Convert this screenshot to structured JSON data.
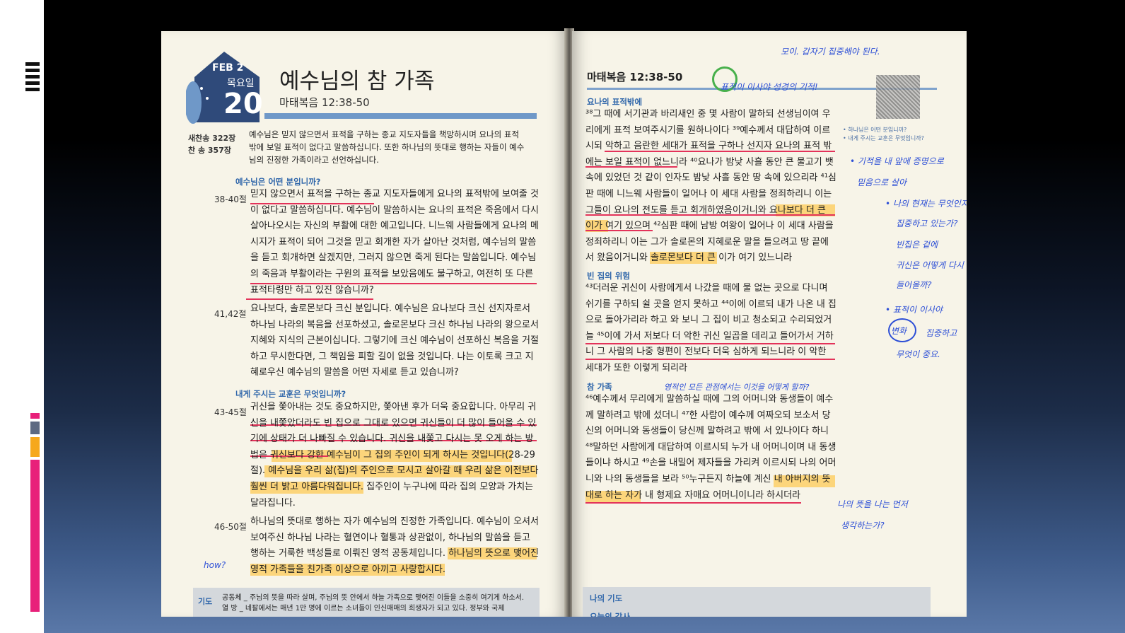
{
  "left_page": {
    "month": "FEB 2",
    "weekday": "목요일",
    "day": "20",
    "title": "예수님의 참 가족",
    "reference": "마태복음 12:38-50",
    "hymn1": "새찬송 322장",
    "hymn2": "찬  송 357장",
    "intro": [
      "예수님은 믿지 않으면서 표적을 구하는 종교 지도자들을 책망하시며 요나의 표적",
      "밖에 보일 표적이 없다고 말씀하십니다. 또한 하나님의 뜻대로 행하는 자들이 예수",
      "님의 진정한 가족이라고 선언하십니다."
    ],
    "q1": "예수님은 어떤 분입니까?",
    "v1_no": "38-40절",
    "v1": [
      "믿지 않으면서 표적을 구하는 종교 지도자들에게 요나의 표적밖에 보여줄 것",
      "이 없다고 말씀하십니다. 예수님이 말씀하시는 요나의 표적은 죽음에서 다시",
      "살아나오시는 자신의 부활에 대한 예고입니다. 니느웨 사람들에게 요나의 메",
      "시지가 표적이 되어 그것을 믿고 회개한 자가 살아난 것처럼, 예수님의 말씀",
      "을 듣고 회개하면 살겠지만, 그러지 않으면 죽게 된다는 말씀입니다. 예수님",
      "의 죽음과 부활이라는 구원의 표적을 보았음에도 불구하고, 여전히 또 다른",
      "표적타령만 하고 있진 않습니까?"
    ],
    "v2_no": "41,42절",
    "v2": [
      "요나보다, 솔로몬보다 크신 분입니다. 예수님은 요나보다 크신 선지자로서",
      "하나님 나라의 복음을 선포하셨고, 솔로몬보다 크신 하나님 나라의 왕으로서",
      "지혜와 지식의 근본이십니다. 그렇기에 크신 예수님이 선포하신 복음을 거절",
      "하고 무시한다면, 그 책임을 피할 길이 없을 것입니다. 나는 이토록 크고 지",
      "혜로우신 예수님의 말씀을 어떤 자세로 듣고 있습니까?"
    ],
    "q2": "내게 주시는 교훈은 무엇입니까?",
    "v3_no": "43-45절",
    "v3": [
      "귀신을 쫓아내는 것도 중요하지만, 쫓아낸 후가 더욱 중요합니다. 아무리 귀",
      "신을 내쫓았더라도 빈 집으로 그대로 있으면 귀신들이 더 많이 들어올 수 있",
      "기에 상태가 더 나빠질 수 있습니다. 귀신을 내쫓고 다시는 못 오게 하는 방",
      "법은 귀신보다 강한 예수님이 그 집의 주인이 되게 하시는 것입니다(28-29",
      "절). 예수님을 우리 삶(집)의 주인으로 모시고 살아갈 때 우리 삶은 이전보다",
      "훨씬 더 밝고 아름다워집니다. 집주인이 누구냐에 따라 집의 모양과 가치는",
      "달라집니다."
    ],
    "v4_no": "46-50절",
    "v4": [
      "하나님의 뜻대로 행하는 자가 예수님의 진정한 가족입니다. 예수님이 오셔서",
      "보여주신 하나님 나라는 혈연이나 혈통과 상관없이, 하나님의 말씀을 듣고",
      "행하는 거룩한 백성들로 이뤄진 영적 공동체입니다. 하나님의 뜻으로 맺어진",
      "영적 가족들을 친가족 이상으로 아끼고 사랑합시다."
    ],
    "prayer_label": "기도",
    "prayer_community": "공동체 _ 주님의 뜻을 따라 살며, 주님의 뜻 안에서 하늘 가족으로 맺어진 이들을 소중히 여기게 하소서.",
    "prayer_nation": "열  방 _ 네팔에서는 매년 1만 명에 이르는 소녀들이 인신매매의 희생자가 되고 있다. 정부와 국제",
    "margin_note": "how?"
  },
  "right_page": {
    "reference": "마태복음 12:38-50",
    "sec1": "요나의 표적밖에",
    "sec1_text": [
      "³⁸그 때에 서기관과 바리새인 중 몇 사람이 말하되 선생님이여 우",
      "리에게 표적 보여주시기를 원하나이다 ³⁹예수께서 대답하여 이르",
      "시되 악하고 음란한 세대가 표적을 구하나 선지자 요나의 표적 밖",
      "에는 보일 표적이 없느니라 ⁴⁰요나가 밤낮 사흘 동안 큰 물고기 뱃",
      "속에 있었던 것 같이 인자도 밤낮 사흘 동안 땅 속에 있으리라 ⁴¹심",
      "판 때에 니느웨 사람들이 일어나 이 세대 사람을 정죄하리니 이는",
      "그들이 요나의 전도를 듣고 회개하였음이거니와 요나보다 더 큰",
      "이가 여기 있으며 ⁴²심판 때에 남방 여왕이 일어나 이 세대 사람을",
      "정죄하리니 이는 그가 솔로몬의 지혜로운 말을 들으려고 땅 끝에",
      "서 왔음이거니와 솔로몬보다 더 큰 이가 여기 있느니라"
    ],
    "sec2": "빈 집의 위험",
    "sec2_text": [
      "⁴³더러운 귀신이 사람에게서 나갔을 때에 물 없는 곳으로 다니며",
      "쉬기를 구하되 쉴 곳을 얻지 못하고 ⁴⁴이에 이르되 내가 나온 내 집",
      "으로 돌아가리라 하고 와 보니 그 집이 비고 청소되고 수리되었거",
      "늘 ⁴⁵이에 가서 저보다 더 악한 귀신 일곱을 데리고 들어가서 거하",
      "니 그 사람의 나중 형편이 전보다 더욱 심하게 되느니라 이 악한",
      "세대가 또한 이렇게 되리라"
    ],
    "sec3": "참 가족",
    "sec3_text": [
      "⁴⁶예수께서 무리에게 말씀하실 때에 그의 어머니와 동생들이 예수",
      "께 말하려고 밖에 섰더니 ⁴⁷한 사람이 예수께 여짜오되 보소서 당",
      "신의 어머니와 동생들이 당신께 말하려고 밖에 서 있나이다 하니",
      "⁴⁸말하던 사람에게 대답하여 이르시되 누가 내 어머니이며 내 동생",
      "들이냐 하시고 ⁴⁹손을 내밀어 제자들을 가리켜 이르시되 나의 어머",
      "니와 나의 동생들을 보라 ⁵⁰누구든지 하늘에 계신 내 아버지의 뜻",
      "대로 하는 자가 내 형제요 자매요 어머니이니라 하시더라"
    ],
    "side_questions": [
      "• 하나님은 어떤 분입니까?",
      "• 내게 주시는 교훈은 무엇입니까?"
    ],
    "my_prayer": "나의 기도",
    "today_thanks": "오늘의 감사",
    "notes": {
      "top": "모이. 갑자기 집중해야 된다.",
      "top2": "표적이   이사야   성경의   기적!",
      "r1": "• 기적을  내  앞에  증명으로",
      "r1b": "믿음으로  살아",
      "r2": "• 나의  현재는  무엇인지",
      "r2b": "집중하고  있는가?",
      "r2c": "빈집은  겉에",
      "r2d": "귀신은  어떻게  다시",
      "r2e": "들어올까?",
      "r3": "• 표적이   이사야",
      "r3b": "변화",
      "r3c": "집중하고",
      "r3d": "무엇이  중요.",
      "mid": "영적인  모든   관점에서는   이것을   어떻게  할까?",
      "bottom": "나의  뜻을  나는  먼저",
      "bottom2": "생각하는가?"
    }
  },
  "colors": {
    "accent_gray": "#5d6a82",
    "accent_orange": "#f6a81c",
    "accent_pink": "#e8207a",
    "highlight": "#ffc440",
    "underline": "#e3335a",
    "pen": "#2d4fd6",
    "circle": "#48b04c"
  }
}
